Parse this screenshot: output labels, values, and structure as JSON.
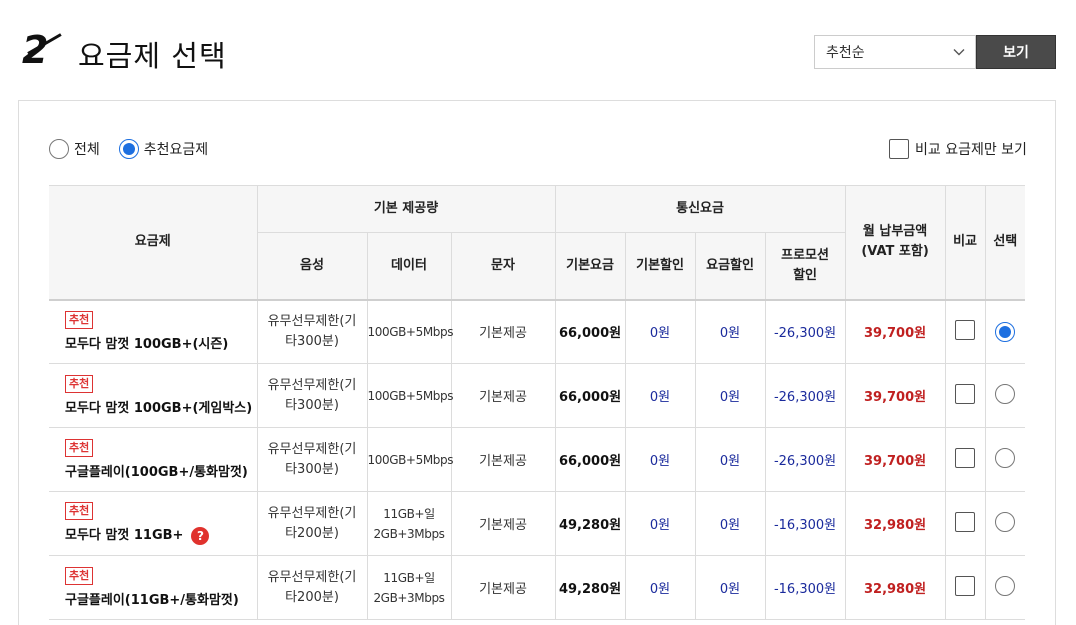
{
  "header": {
    "step_number": "2",
    "title": "요금제 선택",
    "sort_selected": "추천순",
    "view_button": "보기"
  },
  "filters": {
    "all_label": "전체",
    "recommended_label": "추천요금제",
    "selected": "recommended",
    "compare_only_label": "비교 요금제만 보기"
  },
  "table": {
    "headers": {
      "plan": "요금제",
      "base_offer": "기본 제공량",
      "telecom_fee": "통신요금",
      "voice": "음성",
      "data": "데이터",
      "sms": "문자",
      "base_fee": "기본요금",
      "base_discount": "기본할인",
      "fee_discount": "요금할인",
      "promo_discount_1": "프로모션",
      "promo_discount_2": "할인",
      "monthly_1": "월 납부금액",
      "monthly_2": "(VAT 포함)",
      "compare": "비교",
      "select": "선택"
    },
    "rows": [
      {
        "badge": "추천",
        "name": "모두다 맘껏 100GB+(시즌)",
        "voice_1": "유무선무제한(기",
        "voice_2": "타300분)",
        "data_1": "100GB+5Mbps",
        "data_2": "",
        "sms": "기본제공",
        "base_fee": "66,000원",
        "base_discount": "0원",
        "fee_discount": "0원",
        "promo": "-26,300원",
        "monthly": "39,700원",
        "selected": true,
        "help": false
      },
      {
        "badge": "추천",
        "name": "모두다 맘껏 100GB+(게임박스)",
        "voice_1": "유무선무제한(기",
        "voice_2": "타300분)",
        "data_1": "100GB+5Mbps",
        "data_2": "",
        "sms": "기본제공",
        "base_fee": "66,000원",
        "base_discount": "0원",
        "fee_discount": "0원",
        "promo": "-26,300원",
        "monthly": "39,700원",
        "selected": false,
        "help": false
      },
      {
        "badge": "추천",
        "name": "구글플레이(100GB+/통화맘껏)",
        "voice_1": "유무선무제한(기",
        "voice_2": "타300분)",
        "data_1": "100GB+5Mbps",
        "data_2": "",
        "sms": "기본제공",
        "base_fee": "66,000원",
        "base_discount": "0원",
        "fee_discount": "0원",
        "promo": "-26,300원",
        "monthly": "39,700원",
        "selected": false,
        "help": false
      },
      {
        "badge": "추천",
        "name": "모두다 맘껏 11GB+",
        "voice_1": "유무선무제한(기",
        "voice_2": "타200분)",
        "data_1": "11GB+일",
        "data_2": "2GB+3Mbps",
        "sms": "기본제공",
        "base_fee": "49,280원",
        "base_discount": "0원",
        "fee_discount": "0원",
        "promo": "-16,300원",
        "monthly": "32,980원",
        "selected": false,
        "help": true
      },
      {
        "badge": "추천",
        "name": "구글플레이(11GB+/통화맘껏)",
        "voice_1": "유무선무제한(기",
        "voice_2": "타200분)",
        "data_1": "11GB+일",
        "data_2": "2GB+3Mbps",
        "sms": "기본제공",
        "base_fee": "49,280원",
        "base_discount": "0원",
        "fee_discount": "0원",
        "promo": "-16,300원",
        "monthly": "32,980원",
        "selected": false,
        "help": false
      }
    ]
  },
  "icons": {
    "help": "?",
    "help_icon_name": "question-circle-icon",
    "select_chevron": "chevron-down-icon"
  },
  "colors": {
    "accent_blue": "#1d6fe0",
    "discount_blue": "#1a2a9c",
    "price_red": "#c02020",
    "badge_red": "#d33",
    "view_button_bg": "#4a4a4a"
  }
}
